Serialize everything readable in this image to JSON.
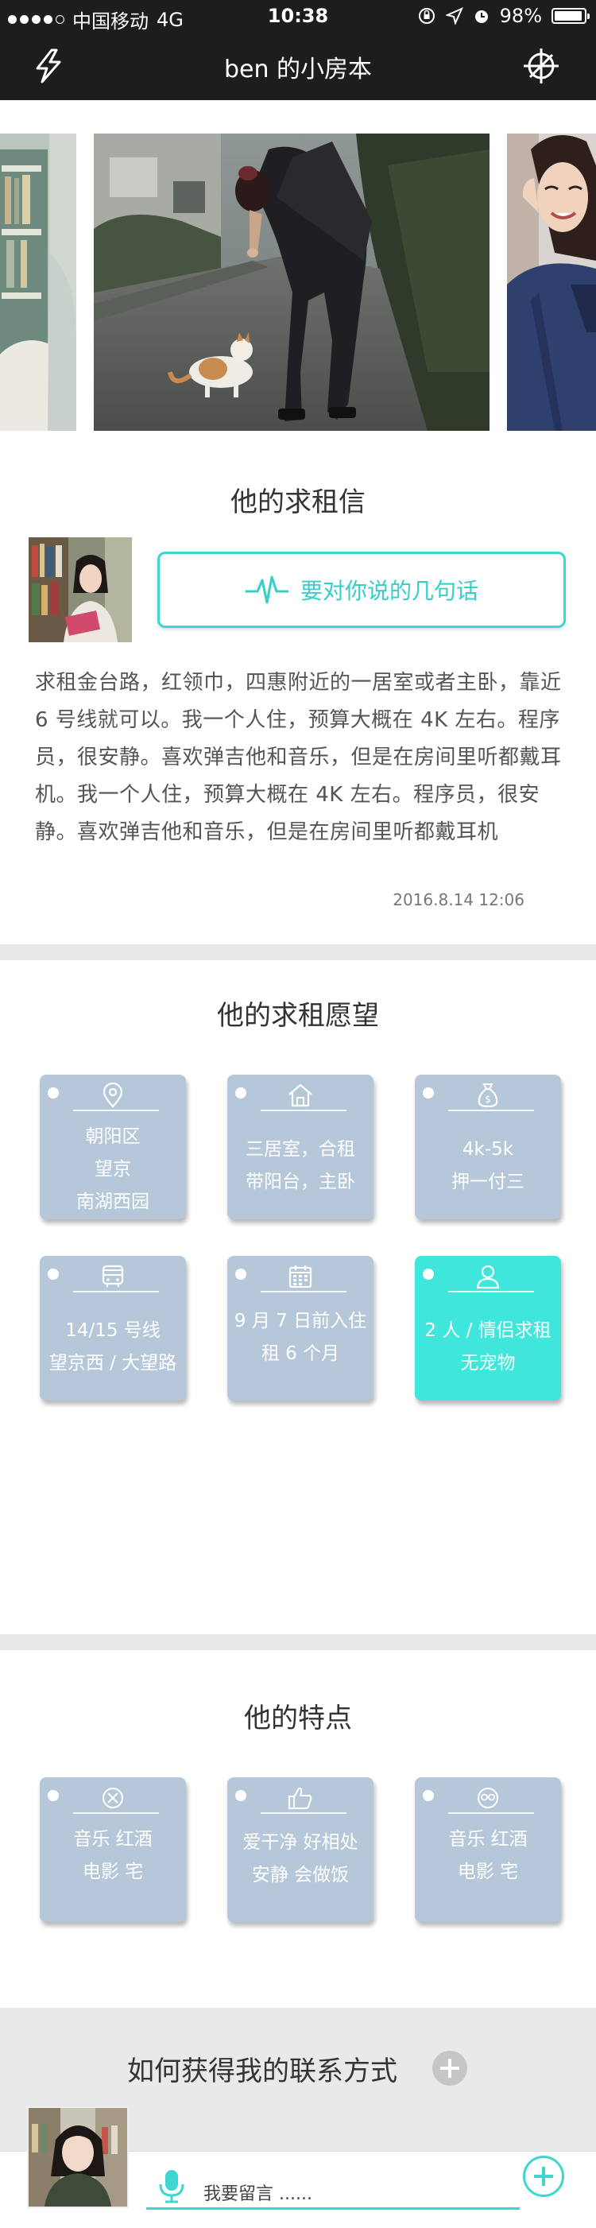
{
  "status_bar": {
    "carrier": "中国移动",
    "network": "4G",
    "time": "10:38",
    "battery": "98%",
    "signal_bars_filled": 4,
    "signal_bars_total": 5
  },
  "nav": {
    "title": "ben 的小房本",
    "left_icon": "lightning-icon",
    "right_icon": "crosshair-icon"
  },
  "letter": {
    "title": "他的求租信",
    "button_label": "要对你说的几句话",
    "body": "求租金台路，红领巾，四惠附近的一居室或者主卧，靠近 6 号线就可以。我一个人住，预算大概在 4K 左右。程序员，很安静。喜欢弹吉他和音乐，但是在房间里听都戴耳机。我一个人住，预算大概在 4K 左右。程序员，很安静。喜欢弹吉他和音乐，但是在房间里听都戴耳机",
    "date": "2016.8.14 12:06"
  },
  "wishes": {
    "title": "他的求租愿望",
    "cards": [
      {
        "icon": "location-pin-icon",
        "lines": [
          "朝阳区",
          "望京",
          "南湖西园"
        ],
        "active": false
      },
      {
        "icon": "house-icon",
        "lines": [
          "三居室，合租",
          "带阳台，主卧"
        ],
        "active": false
      },
      {
        "icon": "money-bag-icon",
        "lines": [
          "4k-5k",
          "押一付三"
        ],
        "active": false
      },
      {
        "icon": "bus-icon",
        "lines": [
          "14/15 号线",
          "望京西 / 大望路"
        ],
        "active": false
      },
      {
        "icon": "calendar-icon",
        "lines": [
          "9 月 7 日前入住",
          "租 6 个月"
        ],
        "active": false
      },
      {
        "icon": "person-icon",
        "lines": [
          "2 人 / 情侣求租",
          "无宠物"
        ],
        "active": true
      }
    ]
  },
  "traits": {
    "title": "他的特点",
    "cards": [
      {
        "icon": "no-smoking-icon",
        "lines": [
          "音乐  红酒",
          "电影  宅"
        ]
      },
      {
        "icon": "thumbs-up-icon",
        "lines": [
          "爱干净 好相处",
          "安静 会做饭"
        ]
      },
      {
        "icon": "glasses-face-icon",
        "lines": [
          "音乐  红酒",
          "电影  宅"
        ]
      }
    ]
  },
  "contact": {
    "title": "如何获得我的联系方式",
    "message_placeholder": "我要留言 ......"
  },
  "colors": {
    "nav_bg": "#1d1d1f",
    "accent": "#3ed6cf",
    "card_bg": "#b5c7d8",
    "card_active_bg": "#3ee6db"
  }
}
